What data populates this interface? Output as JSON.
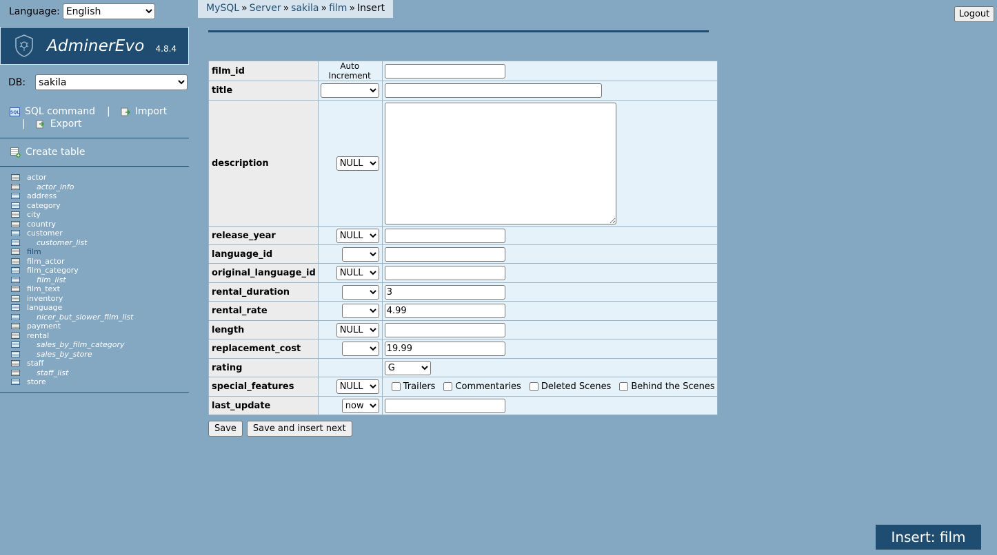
{
  "language": {
    "label": "Language:",
    "selected": "English"
  },
  "logo": {
    "title": "AdminerEvo",
    "version": "4.8.4"
  },
  "db": {
    "label": "DB:",
    "selected": "sakila"
  },
  "links": {
    "sql_command": "SQL command",
    "import": "Import",
    "export": "Export",
    "separator": "|",
    "create_table": "Create table"
  },
  "tables": [
    {
      "name": "actor",
      "view": false
    },
    {
      "name": "actor_info",
      "view": true
    },
    {
      "name": "address",
      "view": false
    },
    {
      "name": "category",
      "view": false
    },
    {
      "name": "city",
      "view": false
    },
    {
      "name": "country",
      "view": false
    },
    {
      "name": "customer",
      "view": false
    },
    {
      "name": "customer_list",
      "view": true
    },
    {
      "name": "film",
      "view": false,
      "active": true
    },
    {
      "name": "film_actor",
      "view": false
    },
    {
      "name": "film_category",
      "view": false
    },
    {
      "name": "film_list",
      "view": true
    },
    {
      "name": "film_text",
      "view": false
    },
    {
      "name": "inventory",
      "view": false
    },
    {
      "name": "language",
      "view": false
    },
    {
      "name": "nicer_but_slower_film_list",
      "view": true
    },
    {
      "name": "payment",
      "view": false
    },
    {
      "name": "rental",
      "view": false
    },
    {
      "name": "sales_by_film_category",
      "view": true
    },
    {
      "name": "sales_by_store",
      "view": true
    },
    {
      "name": "staff",
      "view": false
    },
    {
      "name": "staff_list",
      "view": true
    },
    {
      "name": "store",
      "view": false
    }
  ],
  "breadcrumb": {
    "mysql": "MySQL",
    "server": "Server",
    "db": "sakila",
    "table": "film",
    "current": "Insert",
    "sep": "»"
  },
  "logout": "Logout",
  "fields": {
    "film_id": {
      "label": "film_id",
      "func": "Auto Increment",
      "value": ""
    },
    "title": {
      "label": "title",
      "func": "",
      "value": ""
    },
    "description": {
      "label": "description",
      "func": "NULL",
      "value": ""
    },
    "release_year": {
      "label": "release_year",
      "func": "NULL",
      "value": ""
    },
    "language_id": {
      "label": "language_id",
      "func": "",
      "value": ""
    },
    "original_language_id": {
      "label": "original_language_id",
      "func": "NULL",
      "value": ""
    },
    "rental_duration": {
      "label": "rental_duration",
      "func": "",
      "value": "3"
    },
    "rental_rate": {
      "label": "rental_rate",
      "func": "",
      "value": "4.99"
    },
    "length": {
      "label": "length",
      "func": "NULL",
      "value": ""
    },
    "replacement_cost": {
      "label": "replacement_cost",
      "func": "",
      "value": "19.99"
    },
    "rating": {
      "label": "rating",
      "value": "G"
    },
    "special_features": {
      "label": "special_features",
      "func": "NULL",
      "options": [
        "Trailers",
        "Commentaries",
        "Deleted Scenes",
        "Behind the Scenes"
      ]
    },
    "last_update": {
      "label": "last_update",
      "func": "now",
      "value": ""
    }
  },
  "buttons": {
    "save": "Save",
    "save_insert_next": "Save and insert next"
  },
  "page_title": "Insert: film",
  "colors": {
    "background": "#84a7c2",
    "accent": "#1f4d72",
    "row_bg": "#e6f2fa",
    "header_bg": "#ececec"
  }
}
